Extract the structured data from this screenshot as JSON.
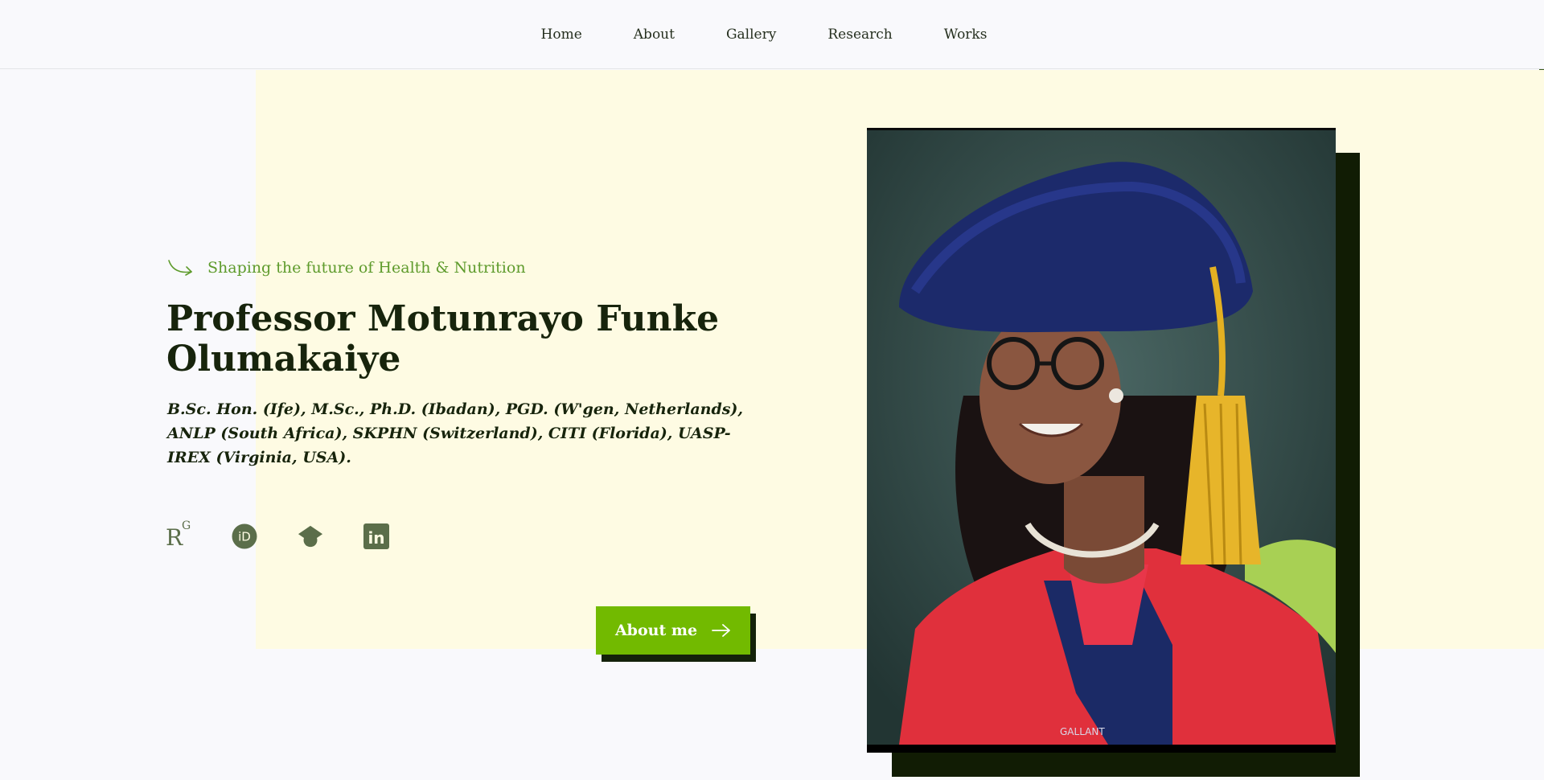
{
  "nav": {
    "links": [
      "Home",
      "About",
      "Gallery",
      "Research",
      "Works"
    ]
  },
  "hero": {
    "tagline": "Shaping the future of Health & Nutrition",
    "name": "Professor Motunrayo Funke Olumakaiye",
    "credentials": "B.Sc. Hon. (Ife), M.Sc., Ph.D. (Ibadan), PGD. (W'gen, Netherlands), ANLP (South Africa), SKPHN (Switzerland), CITI (Florida), UASP-IREX (Virginia, USA).",
    "social_icons": [
      "researchgate-icon",
      "orcid-icon",
      "google-scholar-icon",
      "linkedin-icon"
    ],
    "researchgate_letters": {
      "main": "R",
      "sup": "G"
    },
    "orcid_letters": "iD",
    "linkedin_letters": "in",
    "cta_label": "About me",
    "photo_watermark": "GALLANT"
  },
  "colors": {
    "accent_green": "#72ba00",
    "tagline_green": "#5e9b2c",
    "heading_dark": "#17240c",
    "hero_background": "#fefbe3",
    "icon_green": "#5b6e4a"
  }
}
